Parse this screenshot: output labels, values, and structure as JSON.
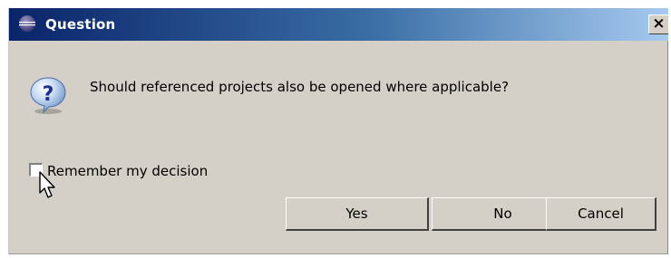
{
  "dialog": {
    "title": "Question",
    "close_label": "×",
    "message": "Should referenced projects also be opened where applicable?",
    "checkbox_label": "Remember my decision",
    "checkbox_checked": false,
    "buttons": {
      "yes": "Yes",
      "no": "No",
      "cancel": "Cancel"
    },
    "icons": {
      "title": "eclipse-icon",
      "message": "question-icon",
      "cursor": "mouse-pointer-icon"
    }
  },
  "colors": {
    "titlebar_start": "#0a246a",
    "titlebar_end": "#a6caf0",
    "dialog_background": "#d4d0c8"
  }
}
